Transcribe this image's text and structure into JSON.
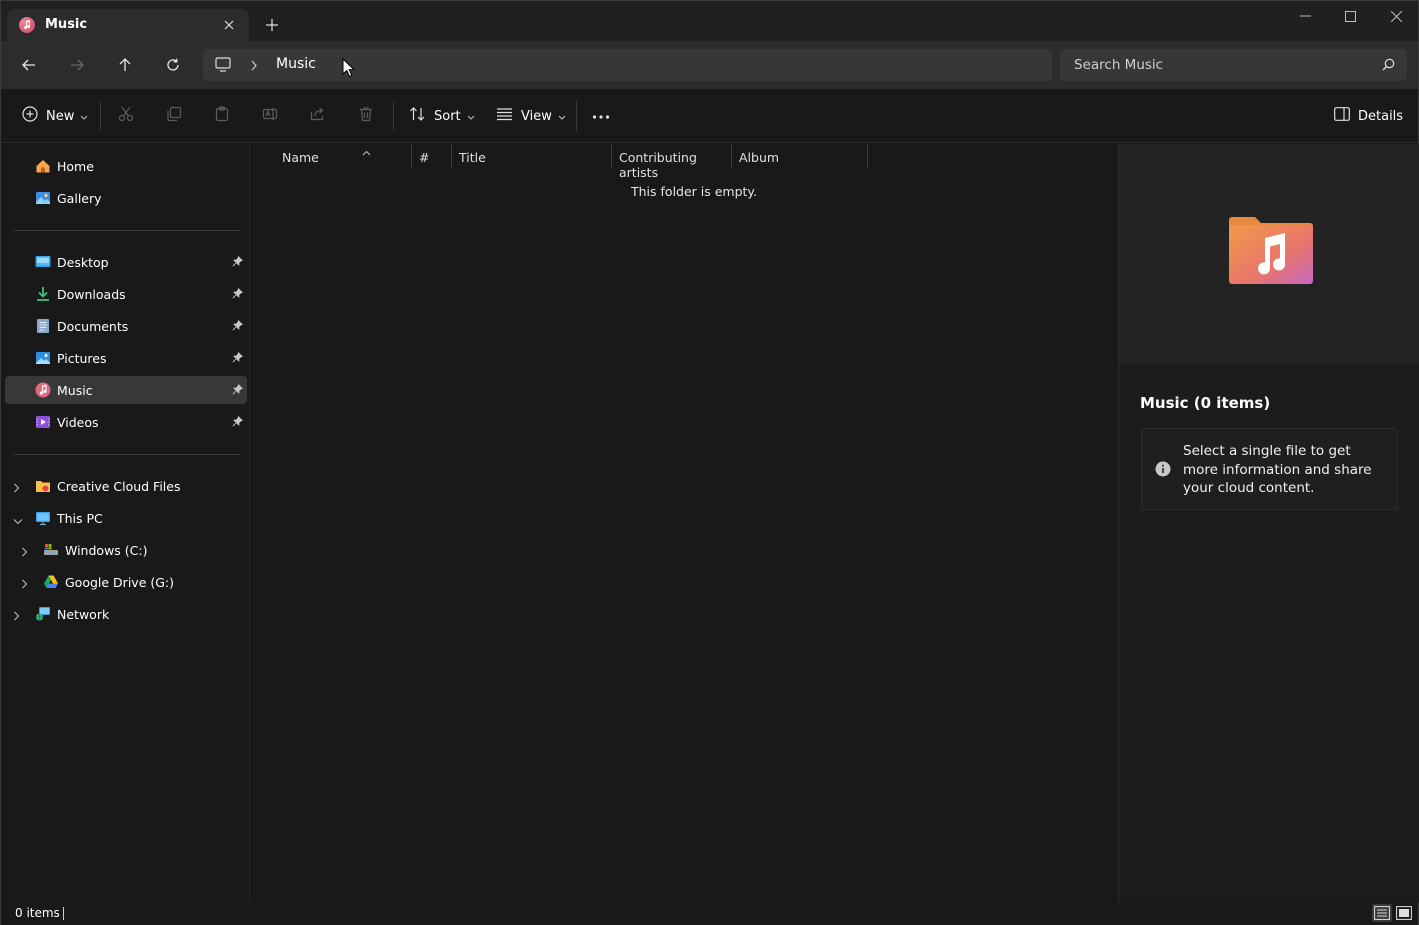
{
  "tab": {
    "title": "Music"
  },
  "address": {
    "crumbs": [
      "Music"
    ]
  },
  "search": {
    "placeholder": "Search Music"
  },
  "toolbar": {
    "new_label": "New",
    "sort_label": "Sort",
    "view_label": "View",
    "details_label": "Details"
  },
  "sidebar": {
    "quick": [
      {
        "label": "Home",
        "icon": "home-icon"
      },
      {
        "label": "Gallery",
        "icon": "gallery-icon"
      }
    ],
    "pinned": [
      {
        "label": "Desktop",
        "icon": "desktop-folder-icon",
        "pinned": true
      },
      {
        "label": "Downloads",
        "icon": "downloads-folder-icon",
        "pinned": true
      },
      {
        "label": "Documents",
        "icon": "documents-folder-icon",
        "pinned": true
      },
      {
        "label": "Pictures",
        "icon": "pictures-folder-icon",
        "pinned": true
      },
      {
        "label": "Music",
        "icon": "music-folder-icon",
        "pinned": true,
        "selected": true
      },
      {
        "label": "Videos",
        "icon": "videos-folder-icon",
        "pinned": true
      }
    ],
    "tree": [
      {
        "label": "Creative Cloud Files",
        "icon": "creative-cloud-icon",
        "expanded": false
      },
      {
        "label": "This PC",
        "icon": "this-pc-icon",
        "expanded": true
      },
      {
        "label": "Windows (C:)",
        "icon": "drive-c-icon",
        "expanded": false
      },
      {
        "label": "Google Drive (G:)",
        "icon": "google-drive-icon",
        "expanded": false
      },
      {
        "label": "Network",
        "icon": "network-icon",
        "expanded": false
      }
    ]
  },
  "columns": [
    "Name",
    "#",
    "Title",
    "Contributing artists",
    "Album"
  ],
  "content": {
    "empty_message": "This folder is empty."
  },
  "details": {
    "title": "Music (0 items)",
    "info": "Select a single file to get more information and share your cloud content."
  },
  "status": {
    "item_count": "0 items"
  },
  "colors": {
    "background": "#191919",
    "selected": "#383838",
    "accent": "#60cdff"
  }
}
